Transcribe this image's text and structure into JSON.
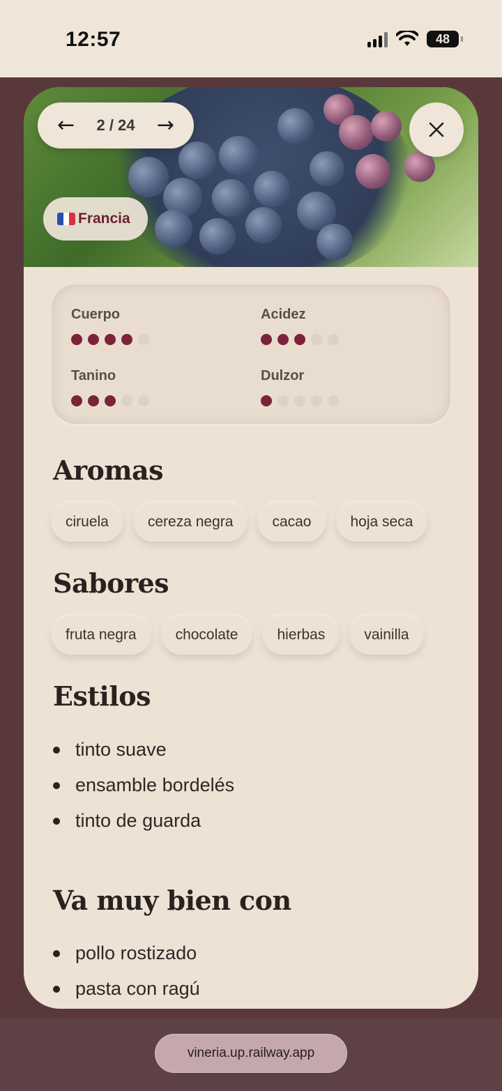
{
  "status_bar": {
    "time": "12:57",
    "battery": "48"
  },
  "header": {
    "counter": "2 / 24",
    "prev_arrow": "←",
    "next_arrow": "→"
  },
  "country": {
    "label": "Francia",
    "flag_colors": [
      "#2b4fb0",
      "#ffffff",
      "#d8323f"
    ]
  },
  "attributes": [
    {
      "label": "Cuerpo",
      "level": 4,
      "max": 5
    },
    {
      "label": "Acidez",
      "level": 3,
      "max": 5
    },
    {
      "label": "Tanino",
      "level": 3,
      "max": 5
    },
    {
      "label": "Dulzor",
      "level": 1,
      "max": 5
    }
  ],
  "aromas": {
    "title": "Aromas",
    "items": [
      "ciruela",
      "cereza negra",
      "cacao",
      "hoja seca"
    ]
  },
  "sabores": {
    "title": "Sabores",
    "items": [
      "fruta negra",
      "chocolate",
      "hierbas",
      "vainilla"
    ]
  },
  "estilos": {
    "title": "Estilos",
    "items": [
      "tinto suave",
      "ensamble bordelés",
      "tinto de guarda"
    ]
  },
  "maridaje": {
    "title": "Va muy bien con",
    "items": [
      "pollo rostizado",
      "pasta con ragú"
    ]
  },
  "browser": {
    "url": "vineria.up.railway.app"
  },
  "colors": {
    "accent": "#7b2338",
    "card_bg": "#ede2d4",
    "backdrop": "#59383b"
  }
}
